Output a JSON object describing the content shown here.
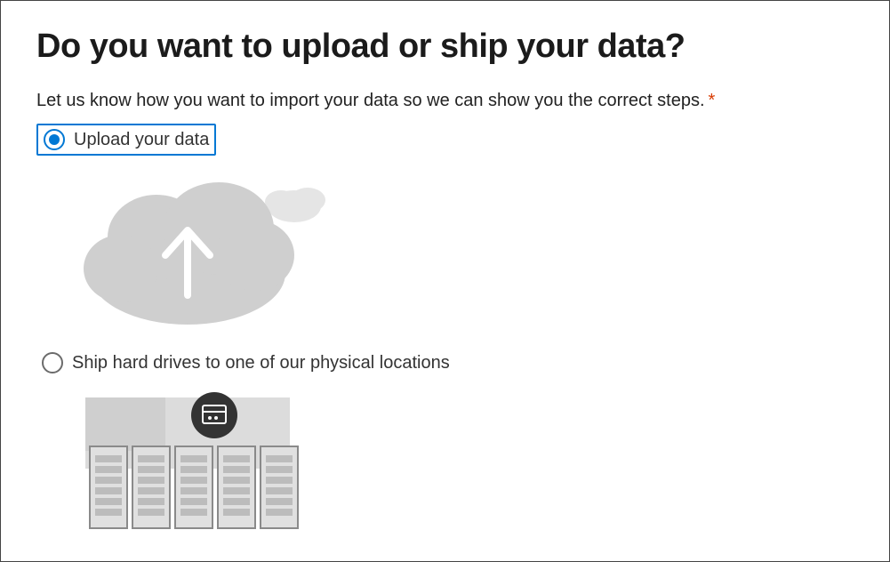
{
  "page": {
    "title": "Do you want to upload or ship your data?",
    "subtitle": "Let us know how you want to import your data so we can show you the correct steps.",
    "required_mark": "*"
  },
  "options": {
    "upload": {
      "label": "Upload your data",
      "selected": true
    },
    "ship": {
      "label": "Ship hard drives to one of our physical locations",
      "selected": false
    }
  }
}
